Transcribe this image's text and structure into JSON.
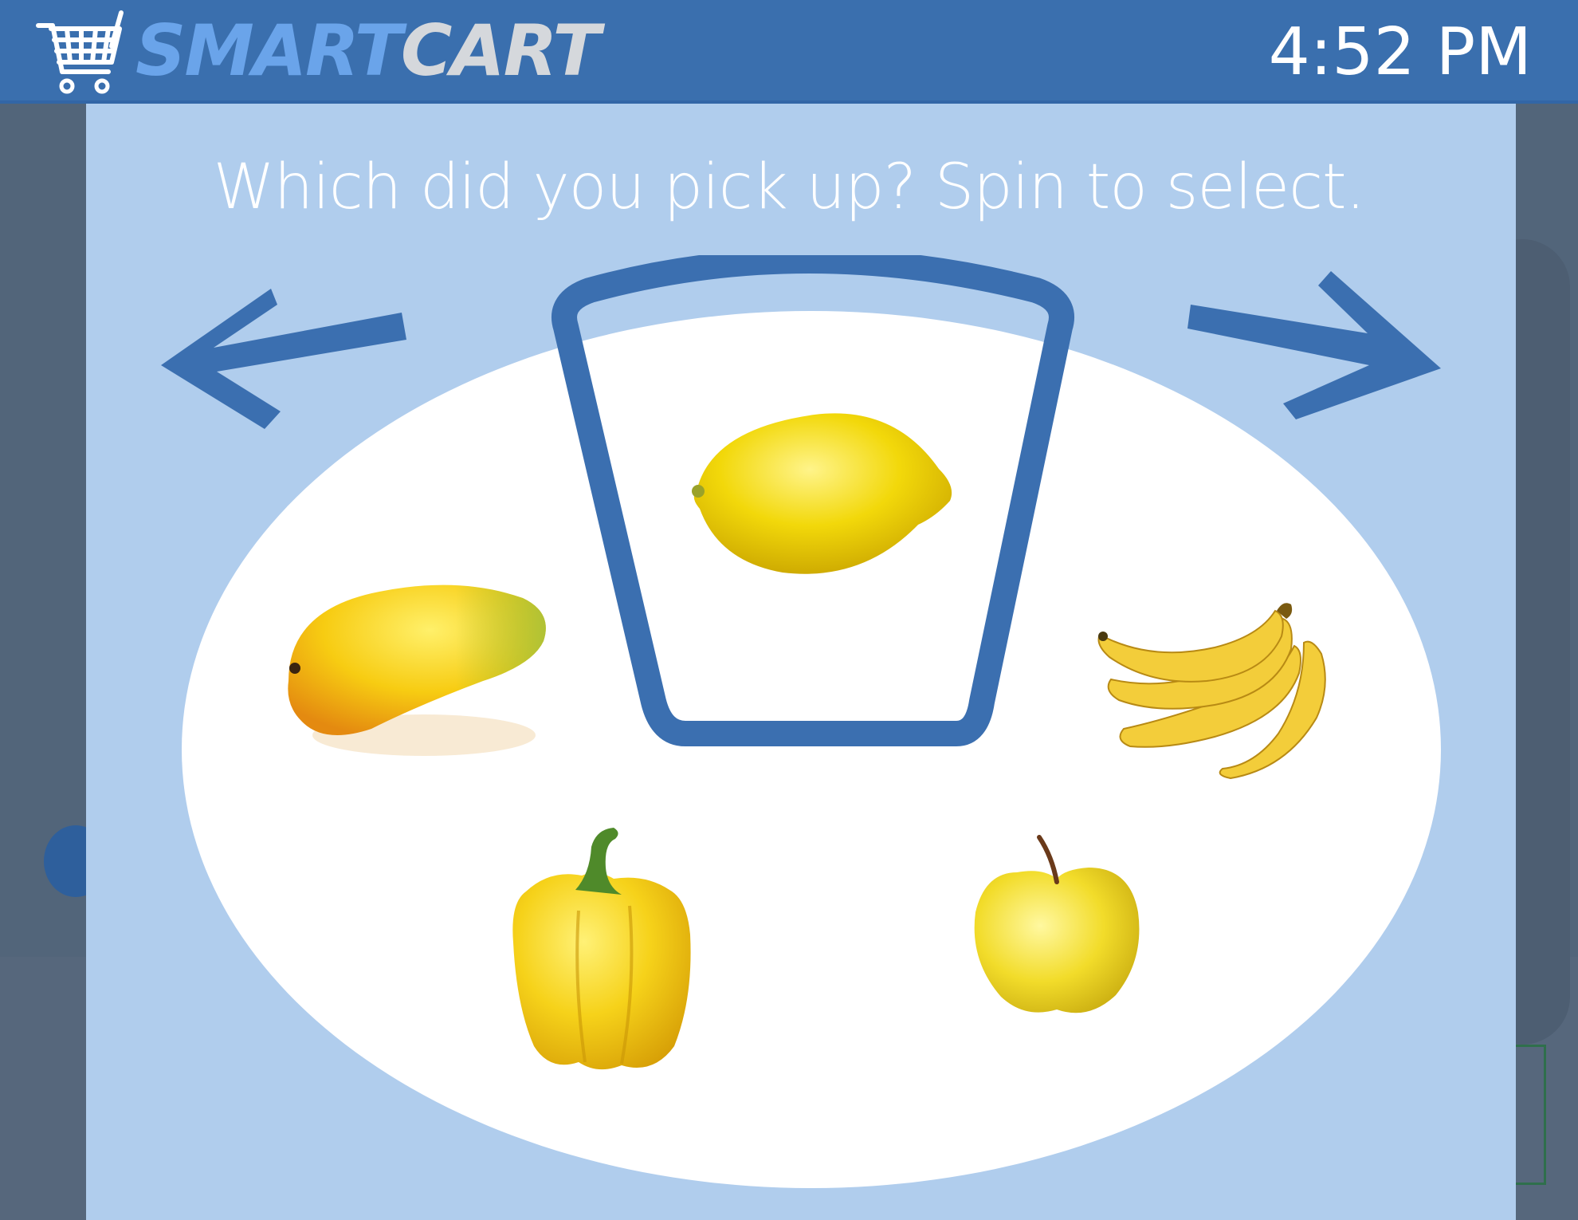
{
  "header": {
    "brand_primary": "SMART",
    "brand_secondary": "CART",
    "time": "4:52 PM",
    "cart_icon": "shopping-cart-icon"
  },
  "main": {
    "prompt": "Which did you pick up? Spin to select.",
    "nav": {
      "left_icon": "arrow-left-icon",
      "right_icon": "arrow-right-icon"
    },
    "carousel": {
      "selected": "lemon",
      "items": [
        {
          "id": "lemon",
          "icon": "lemon-icon"
        },
        {
          "id": "mango",
          "icon": "mango-icon"
        },
        {
          "id": "banana",
          "icon": "banana-icon"
        },
        {
          "id": "bell-pepper",
          "icon": "bell-pepper-icon"
        },
        {
          "id": "apple",
          "icon": "apple-icon"
        }
      ]
    }
  },
  "colors": {
    "header_bg": "#3a6fae",
    "brand_primary": "#6aa4ea",
    "brand_secondary": "#d5d8dc",
    "panel_bg": "#b0cded",
    "accent": "#3b6fb0",
    "fruit_yellow": "#f5d80a"
  }
}
